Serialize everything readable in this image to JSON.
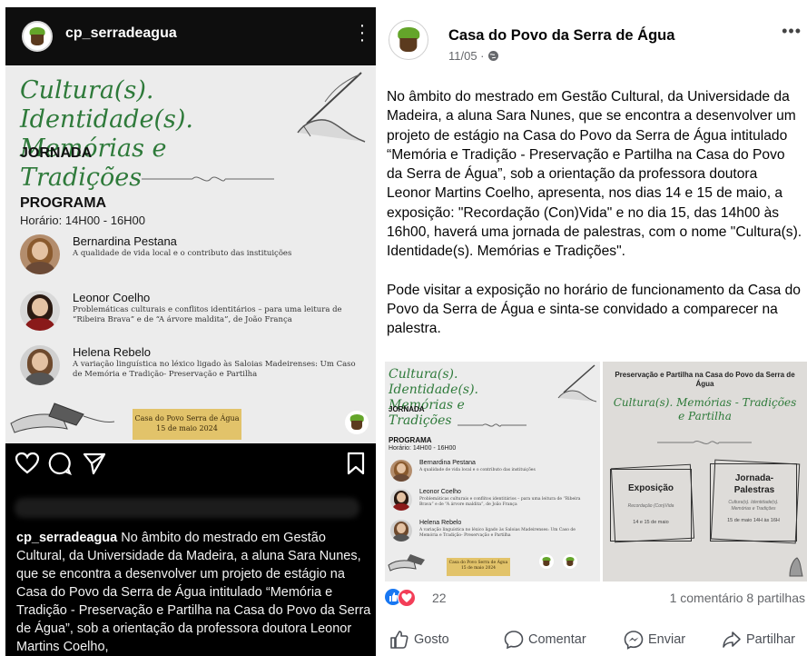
{
  "instagram": {
    "username": "cp_serradeagua",
    "post": {
      "title": "Cultura(s). Identidade(s). Memórias e Tradições",
      "jornada": "JORNADA",
      "programa": "PROGRAMA",
      "horario": "Horário: 14H00 - 16H00",
      "speakers": [
        {
          "name": "Bernardina Pestana",
          "desc": "A qualidade de vida local e o contributo das instituições"
        },
        {
          "name": "Leonor Coelho",
          "desc": "Problemáticas culturais e conflitos identitários – para uma leitura de “Ribeira Brava” e de “A árvore maldita”, de João França"
        },
        {
          "name": "Helena Rebelo",
          "desc": "A variação linguística no léxico ligado às Saloias Madeirenses: Um Caso de Memória e Tradição- Preservação e Partilha"
        }
      ],
      "date_place": "Casa do Povo Serra de Água",
      "date": "15 de maio 2024"
    },
    "caption_user": "cp_serradeagua",
    "caption_text": "No âmbito do mestrado em Gestão Cultural, da Universidade da Madeira, a aluna Sara Nunes, que se encontra a desenvolver um projeto de estágio na Casa do Povo da Serra de Água intitulado “Memória e Tradição - Preservação e Partilha na Casa do Povo da Serra de Água”, sob a orientação da professora doutora Leonor Martins Coelho,"
  },
  "facebook": {
    "page_name": "Casa do Povo da Serra de Água",
    "meta": "11/05 · ",
    "paragraph1": "No âmbito do mestrado em Gestão Cultural, da Universidade da Madeira, a aluna Sara Nunes, que se encontra a desenvolver um projeto de estágio na Casa do Povo da Serra de Água intitulado “Memória e Tradição - Preservação e Partilha na Casa do Povo da Serra de Água”, sob a orientação da professora doutora Leonor Martins Coelho, apresenta, nos dias 14 e 15 de maio, a exposição: \"Recordação (Con)Vida\" e no dia 15, das 14h00 às 16h00, haverá uma jornada de palestras, com o nome \"Cultura(s). Identidade(s). Memórias e Tradições\".",
    "paragraph2": "Pode visitar a exposição no horário de funcionamento da Casa do Povo da Serra de Água e sinta-se convidado a comparecer na palestra.",
    "image2": {
      "title": "Preservação e Partilha na Casa do Povo da Serra de Água",
      "subtitle": "Cultura(s). Memórias - Tradições e Partilha",
      "box1_title": "Exposição",
      "box1_sub": "Recordação (Con)Vida",
      "box1_date": "14 e 15 de maio",
      "box2_title": "Jornada- Palestras",
      "box2_sub": "Cultura(s). Identidade(s). Memórias e Tradições",
      "box2_date": "15 de maio 14H às 16H"
    },
    "reaction_count": "22",
    "stats": "1 comentário  8 partilhas",
    "buttons": {
      "like": "Gosto",
      "comment": "Comentar",
      "send": "Enviar",
      "share": "Partilhar"
    },
    "colors": {
      "like_blue": "#1877f2",
      "love_red": "#f33e58",
      "script_green": "#2e7a3a"
    }
  }
}
